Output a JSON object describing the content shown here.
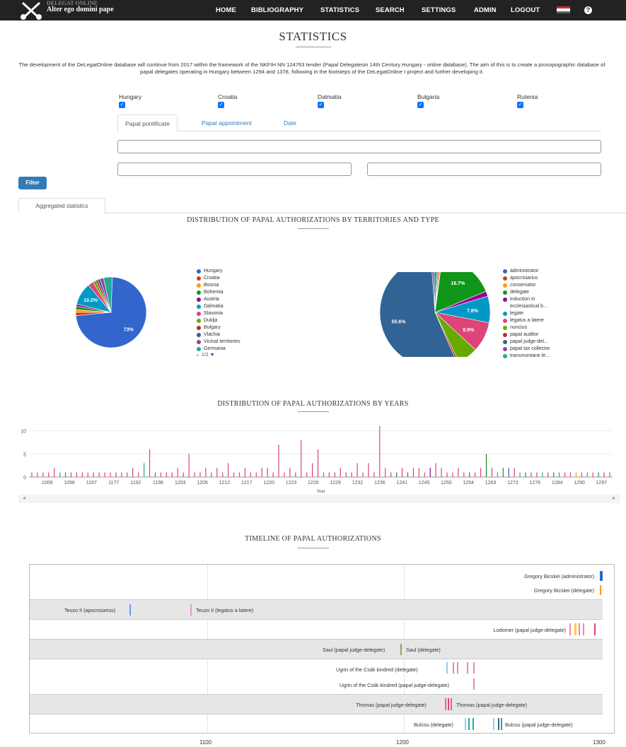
{
  "nav": {
    "brand_line1": "DELEGAT ONLINE",
    "brand_line2": "Alter ego domini pape",
    "links": [
      "HOME",
      "BIBLIOGRAPHY",
      "STATISTICS",
      "SEARCH",
      "SETTINGS",
      "ADMIN",
      "LOGOUT"
    ],
    "help_symbol": "?"
  },
  "page_title": "STATISTICS",
  "intro": "The development of the DeLegatOnline database will continue from 2017 within the framework of the NKFIH NN 124763 tender (Papal Delegatesin 14th Century Hungary - online database). The aim of this is to create a prosopographic database of papal delegates operating in Hungary between 1294 and 1378, following in the footsteps of the DeLegatOnline I project and further developing it.",
  "territory_filters": [
    {
      "label": "Hungary",
      "checked": true
    },
    {
      "label": "Croatia",
      "checked": true
    },
    {
      "label": "Dalmatia",
      "checked": true
    },
    {
      "label": "Bulgaria",
      "checked": true
    },
    {
      "label": "Rutenia",
      "checked": true
    }
  ],
  "filter_tabs": [
    "Papal pontificate",
    "Papal appointment",
    "Date"
  ],
  "filter_button": "Filter",
  "results_tab": "Aggregated statistics",
  "dist_title": "DISTRIBUTION OF PAPAL AUTHORIZATIONS BY TERRITORIES AND TYPE",
  "years_title": "DISTRIBUTION OF PAPAL AUTHORIZATIONS BY YEARS",
  "timeline_title": "TIMELINE OF PAPAL AUTHORIZATIONS",
  "pager": "1/2",
  "chart_data": [
    {
      "type": "pie",
      "labels": [
        "Hungary",
        "Croatia",
        "Bosnia",
        "Bohemia",
        "Austria",
        "Dalmatia",
        "Slavonia",
        "Duklja",
        "Bulgary",
        "Vlachia",
        "Vicinal territories",
        "Germania"
      ],
      "colors": [
        "#3366cc",
        "#dc3912",
        "#ff9900",
        "#109618",
        "#990099",
        "#0099c6",
        "#dd4477",
        "#66aa00",
        "#b82e2e",
        "#316395",
        "#994499",
        "#22aa99"
      ],
      "values": [
        73,
        1.5,
        1.2,
        1.5,
        1,
        10.2,
        2.5,
        1.3,
        1,
        1.2,
        1.6,
        4
      ],
      "data_labels": [
        "73%",
        "",
        "",
        "",
        "",
        "10.2%",
        "",
        "",
        "",
        "",
        "",
        ""
      ]
    },
    {
      "type": "pie",
      "labels": [
        "administrator",
        "apocrisiarius",
        "conservator",
        "delegate",
        "induction in ecclesiastical b...",
        "legate",
        "legatus a latere",
        "nuncius",
        "papal auditor",
        "papal judge-del...",
        "papal tax collector",
        "transmontane le..."
      ],
      "colors": [
        "#3366cc",
        "#dc3912",
        "#ff9900",
        "#109618",
        "#990099",
        "#0099c6",
        "#dd4477",
        "#66aa00",
        "#b82e2e",
        "#316395",
        "#994499",
        "#22aa99"
      ],
      "values": [
        0.4,
        0.5,
        0.4,
        16.7,
        1.5,
        7.8,
        8.9,
        6,
        0.6,
        55.6,
        0.8,
        1.2
      ],
      "data_labels": [
        "",
        "",
        "",
        "16.7%",
        "",
        "7.8%",
        "8.9%",
        "",
        "",
        "55.6%",
        "",
        ""
      ]
    },
    {
      "type": "bar",
      "xlabel": "Year",
      "ylim": [
        0,
        11
      ],
      "yticks": [
        0,
        5,
        10
      ],
      "tick_labels": [
        "1009",
        "1096",
        "1167",
        "1177",
        "1192",
        "1198",
        "1203",
        "1206",
        "1212",
        "1217",
        "1220",
        "1223",
        "1226",
        "1229",
        "1232",
        "1236",
        "1241",
        "1245",
        "1250",
        "1254",
        "1263",
        "1272",
        "1276",
        "1284",
        "1290",
        "1297"
      ],
      "values": [
        1,
        1,
        1,
        1,
        2,
        1,
        1,
        1,
        1,
        1,
        1,
        1,
        1,
        1,
        1,
        1,
        1,
        1,
        2,
        1,
        3,
        6,
        1,
        1,
        1,
        1,
        2,
        1,
        5,
        1,
        1,
        2,
        1,
        2,
        1,
        3,
        1,
        1,
        2,
        1,
        1,
        2,
        2,
        1,
        7,
        1,
        2,
        1,
        8,
        1,
        3,
        6,
        1,
        1,
        1,
        2,
        1,
        1,
        3,
        1,
        3,
        1,
        11,
        2,
        1,
        1,
        2,
        1,
        2,
        2,
        1,
        2,
        3,
        2,
        1,
        1,
        2,
        1,
        1,
        1,
        2,
        5,
        2,
        1,
        2,
        2,
        2,
        1,
        1,
        1,
        1,
        1,
        1,
        1,
        1,
        1,
        1,
        1,
        1,
        1,
        1,
        1,
        1,
        1
      ],
      "colors": [
        "#dd4477",
        "#dd4477",
        "#dd4477",
        "#dd4477",
        "#dd4477",
        "#22aa99",
        "#0099c6",
        "#dd4477",
        "#dd4477",
        "#dd4477",
        "#dd4477",
        "#dd4477",
        "#dd4477",
        "#dd4477",
        "#dd4477",
        "#dd4477",
        "#dd4477",
        "#dd4477",
        "#dd4477",
        "#dd4477",
        "#22aa99",
        "#dd4477",
        "#dd4477",
        "#dd4477",
        "#dd4477",
        "#dd4477",
        "#dd4477",
        "#dd4477",
        "#dd4477",
        "#dd4477",
        "#dd4477",
        "#dd4477",
        "#dd4477",
        "#dd4477",
        "#dd4477",
        "#dd4477",
        "#dd4477",
        "#dd4477",
        "#dd4477",
        "#dd4477",
        "#dd4477",
        "#dd4477",
        "#dd4477",
        "#dd4477",
        "#dd4477",
        "#dd4477",
        "#dd4477",
        "#dd4477",
        "#dd4477",
        "#dd4477",
        "#dd4477",
        "#dd4477",
        "#dd4477",
        "#dd4477",
        "#dd4477",
        "#dd4477",
        "#dd4477",
        "#dd4477",
        "#dd4477",
        "#dd4477",
        "#dd4477",
        "#dd4477",
        "#dd4477",
        "#dd4477",
        "#dd4477",
        "#316395",
        "#dd4477",
        "#109618",
        "#dd4477",
        "#dd4477",
        "#dd4477",
        "#990099",
        "#dd4477",
        "#dd4477",
        "#dd4477",
        "#dd4477",
        "#dd4477",
        "#dd4477",
        "#109618",
        "#dd4477",
        "#dd4477",
        "#109618",
        "#dd4477",
        "#22aa99",
        "#109618",
        "#3366cc",
        "#dd4477",
        "#22aa99",
        "#109618",
        "#dd4477",
        "#dd4477",
        "#22aa99",
        "#dd4477",
        "#3366cc",
        "#22aa99",
        "#dd4477",
        "#dd4477",
        "#ff9900",
        "#dd4477",
        "#22aa99",
        "#dd4477",
        "#109618",
        "#dd4477",
        "#dd4477"
      ]
    }
  ],
  "timeline": {
    "axis_labels": [
      "1100",
      "1200",
      "1300"
    ],
    "rows": [
      {
        "shaded": false,
        "labels": [
          {
            "text": "Gregory Bicskei (administrator)"
          },
          {
            "text": "Gregory Bicskei (delegate)"
          }
        ]
      },
      {
        "shaded": true,
        "labels": [
          {
            "text": "Teuzo II (apocrisiarius)"
          },
          {
            "text": "Teuzo II (legatus a latere)"
          }
        ]
      },
      {
        "shaded": false,
        "labels": [
          {
            "text": "Lodomer (papal judge-delegate)"
          }
        ]
      },
      {
        "shaded": true,
        "labels": [
          {
            "text": "Saul (papal judge-delegate)"
          },
          {
            "text": "Saul (delegate)"
          }
        ]
      },
      {
        "shaded": false,
        "labels": [
          {
            "text": "Ugrin of the Csák kindred (delegate)"
          },
          {
            "text": "Ugrin of the Csák kindred (papal judge-delegate)"
          }
        ]
      },
      {
        "shaded": true,
        "labels": [
          {
            "text": "Thomas (papal judge-delegate)"
          },
          {
            "text": "Thomas (papal judge-delegate)"
          }
        ]
      },
      {
        "shaded": false,
        "labels": [
          {
            "text": "Bulcsu (delegate)"
          },
          {
            "text": "Bulcsu (papal judge-delegate)"
          }
        ]
      }
    ]
  }
}
